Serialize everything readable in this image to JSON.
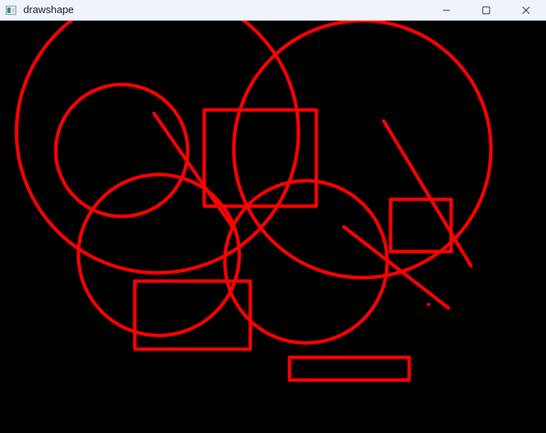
{
  "window": {
    "title": "drawshape",
    "icons": {
      "app": "app-window-icon",
      "minimize": "minimize-icon",
      "maximize": "maximize-icon",
      "close": "close-icon"
    }
  },
  "canvas": {
    "background": "#000000",
    "stroke_color": "#ff0000",
    "shapes": [
      "circle",
      "circle",
      "circle",
      "circle",
      "circle",
      "rectangle",
      "rectangle",
      "rectangle",
      "rectangle",
      "line",
      "line",
      "line",
      "point"
    ]
  }
}
